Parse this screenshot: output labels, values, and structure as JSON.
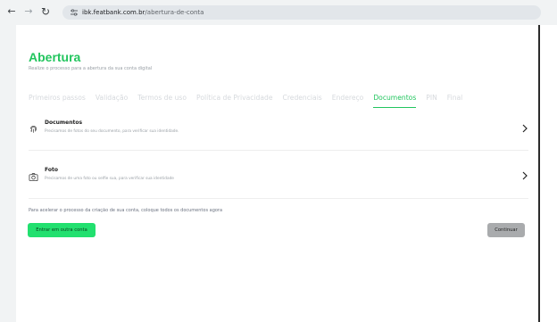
{
  "browser": {
    "url_host": "ibk.featbank.com.br",
    "url_path": "/abertura-de-conta"
  },
  "page": {
    "title": "Abertura",
    "subtitle": "Realize o processo para a abertura da sua conta digital"
  },
  "steps": [
    {
      "label": "Primeiros passos",
      "active": false
    },
    {
      "label": "Validação",
      "active": false
    },
    {
      "label": "Termos de uso",
      "active": false
    },
    {
      "label": "Política de Privacidade",
      "active": false
    },
    {
      "label": "Credenciais",
      "active": false
    },
    {
      "label": "Endereço",
      "active": false
    },
    {
      "label": "Documentos",
      "active": true
    },
    {
      "label": "PIN",
      "active": false
    },
    {
      "label": "Final",
      "active": false
    }
  ],
  "items": [
    {
      "title": "Documentos",
      "description": "Precisamos de fotos do seu documento, para verificar sua identidade.",
      "icon": "fingerprint-icon"
    },
    {
      "title": "Foto",
      "description": "Precisamos de uma foto ou selfie sua, para verificar sua identidade",
      "icon": "camera-icon"
    }
  ],
  "note": "Para acelerar o processo da criação de sua conta, coloque todos os documentos agora",
  "buttons": {
    "enter_other": "Entrar em outra conta",
    "continue": "Continuar"
  },
  "colors": {
    "accent": "#22c55e",
    "button_green": "#22e06f",
    "button_gray": "#a9abad"
  }
}
